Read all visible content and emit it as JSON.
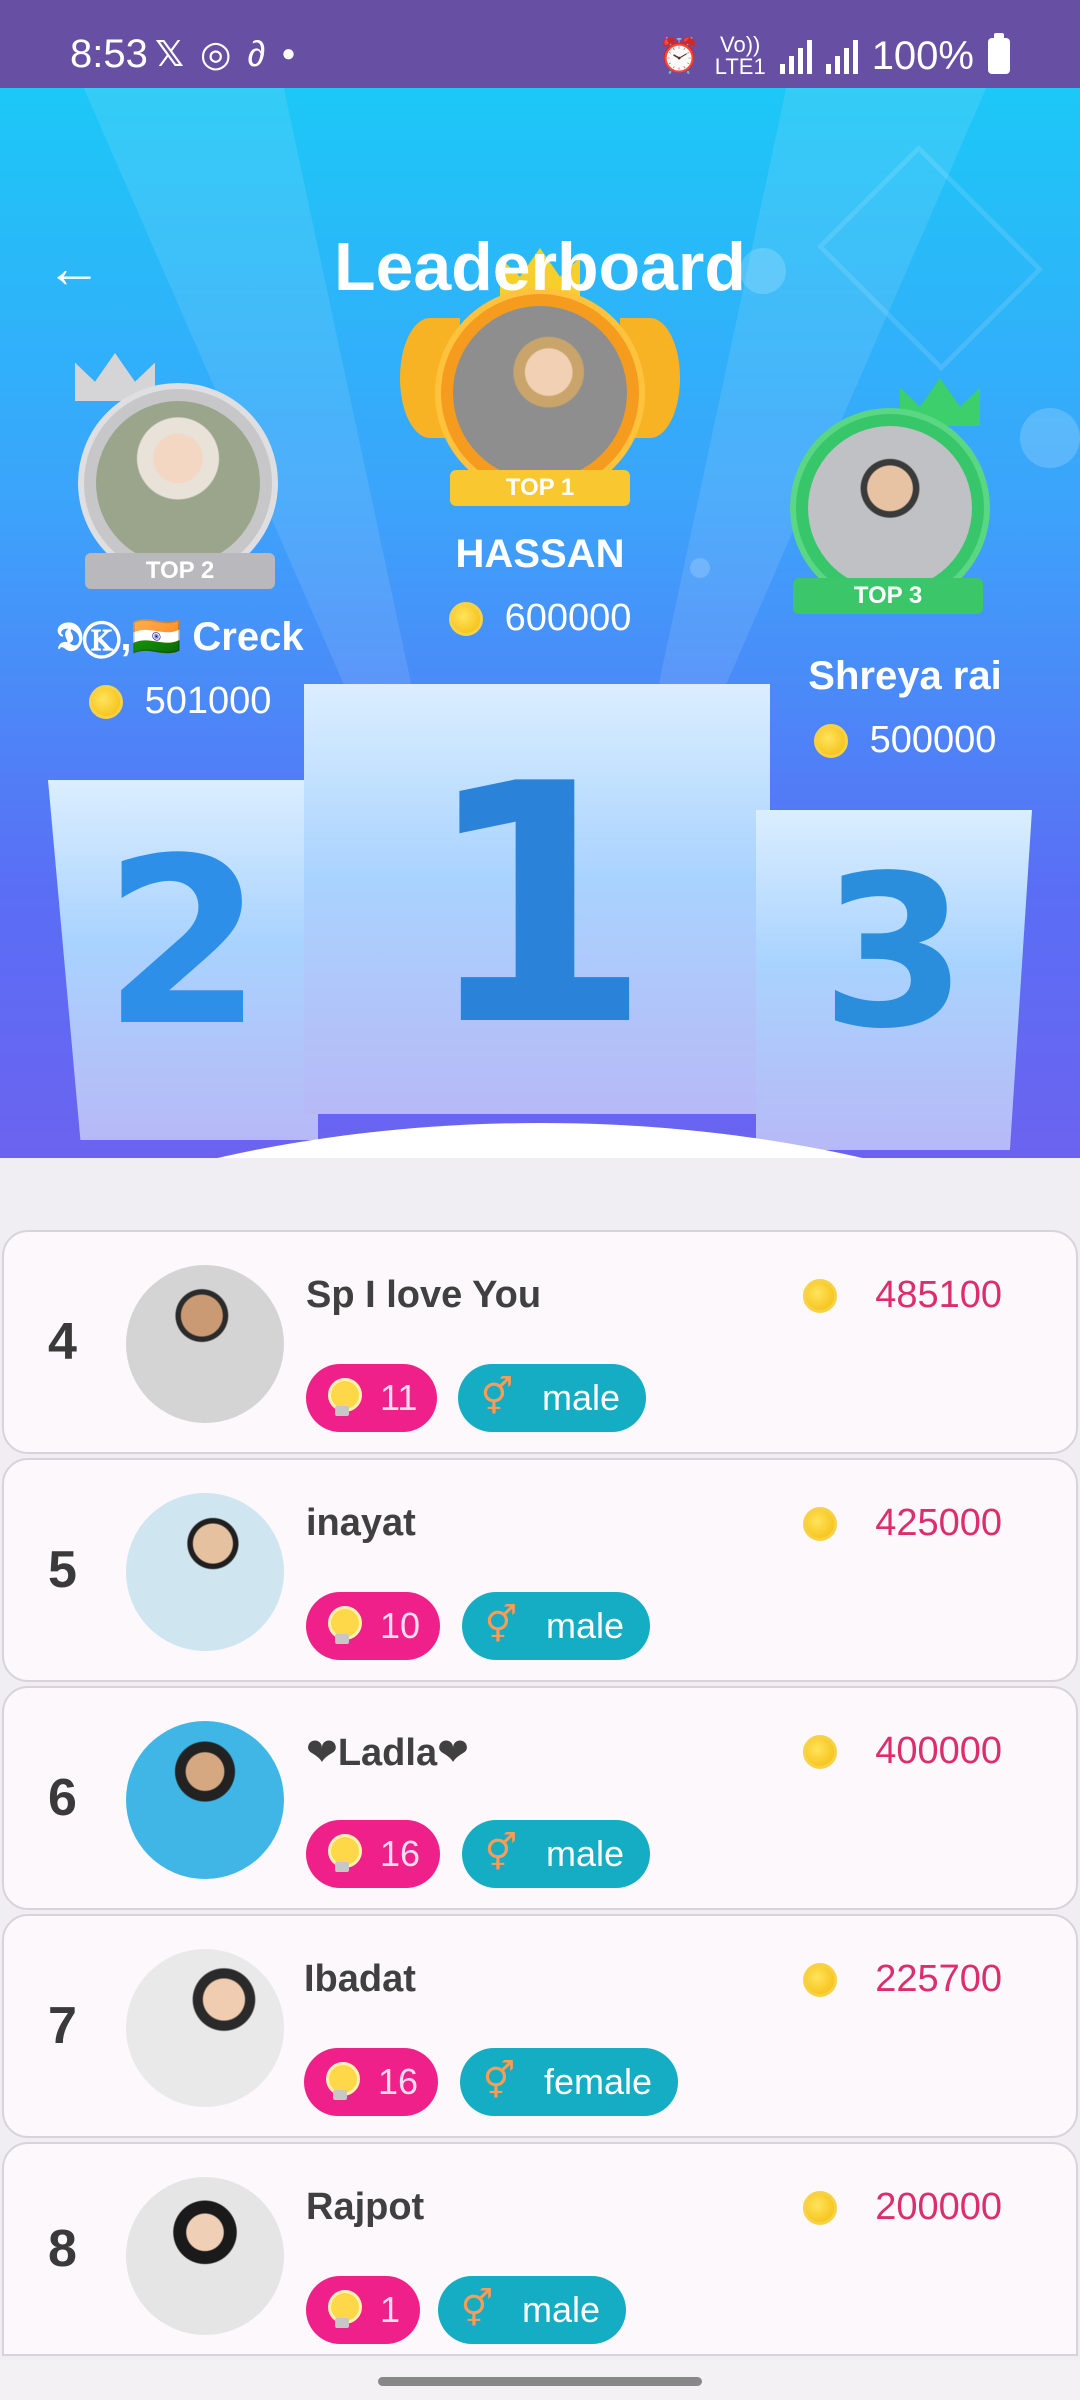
{
  "status_bar": {
    "time": "8:53",
    "app_icons": [
      "X",
      "whatsapp-icon",
      "app-icon",
      "dot"
    ],
    "network_label_top": "Vo))",
    "network_label_bottom": "LTE1",
    "battery": "100%"
  },
  "header": {
    "title": "Leaderboard",
    "back_icon": "arrow-left-icon"
  },
  "top3": [
    {
      "rank_badge": "TOP 2",
      "name": "𝕯Ⓚ,🇮🇳 Creck",
      "coins": "501000",
      "podium_number": "2",
      "ring_color": "#c7c7c9",
      "crown_color": "#d5d5d7"
    },
    {
      "rank_badge": "TOP 1",
      "name": "HASSAN",
      "coins": "600000",
      "podium_number": "1",
      "ring_color": "#f59c1e",
      "crown_color": "#f6cf2b"
    },
    {
      "rank_badge": "TOP 3",
      "name": "Shreya rai",
      "coins": "500000",
      "podium_number": "3",
      "ring_color": "#37c66a",
      "crown_color": "#3ccf6b"
    }
  ],
  "list": [
    {
      "rank": "4",
      "name": "Sp I love You",
      "score": "485100",
      "level": "11",
      "gender": "male"
    },
    {
      "rank": "5",
      "name": "inayat",
      "score": "425000",
      "level": "10",
      "gender": "male"
    },
    {
      "rank": "6",
      "name": "❤Ladla❤",
      "score": "400000",
      "level": "16",
      "gender": "male"
    },
    {
      "rank": "7",
      "name": "Ibadat",
      "score": "225700",
      "level": "16",
      "gender": "female"
    },
    {
      "rank": "8",
      "name": "Rajpot",
      "score": "200000",
      "level": "1",
      "gender": "male"
    }
  ],
  "colors": {
    "status_bar": "#6750a4",
    "score_text": "#dc2e6e",
    "level_chip": "#f0208a",
    "gender_chip": "#15adc3"
  }
}
